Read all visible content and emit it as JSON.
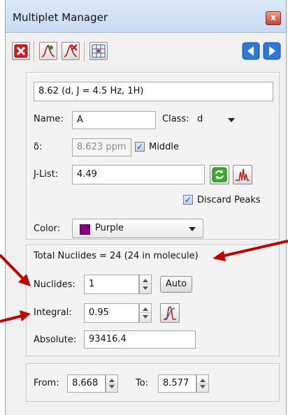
{
  "window": {
    "title": "Multiplet Manager",
    "close_label": "x"
  },
  "toolbar": {
    "buttons": [
      {
        "icon": "delete-x-icon"
      },
      {
        "icon": "add-multiplet-icon"
      },
      {
        "icon": "remove-multiplet-icon"
      },
      {
        "icon": "grid-table-icon"
      },
      {
        "icon": "previous-arrow-icon"
      },
      {
        "icon": "next-arrow-icon"
      }
    ]
  },
  "multiplet": {
    "summary": "8.62 (d, J = 4.5 Hz, 1H)",
    "name_label": "Name:",
    "name_value": "A",
    "class_label": "Class:",
    "class_value": "d",
    "delta_label": "δ:",
    "delta_value": "8.623 ppm",
    "middle_label": "Middle",
    "middle_checked": true,
    "jlist_label": "J-List:",
    "jlist_value": "4.49",
    "discard_label": "Discard Peaks",
    "discard_checked": true,
    "color_label": "Color:",
    "color_value": "Purple",
    "color_swatch": "#800080"
  },
  "nuclides": {
    "total_text": "Total Nuclides = 24 (24 in molecule)",
    "nuclides_label": "Nuclides:",
    "nuclides_value": "1",
    "auto_label": "Auto",
    "integral_label": "Integral:",
    "integral_value": "0.95",
    "absolute_label": "Absolute:",
    "absolute_value": "93416.4"
  },
  "range": {
    "from_label": "From:",
    "from_value": "8.668",
    "to_label": "To:",
    "to_value": "8.577"
  },
  "annotation_color": "#c00000"
}
